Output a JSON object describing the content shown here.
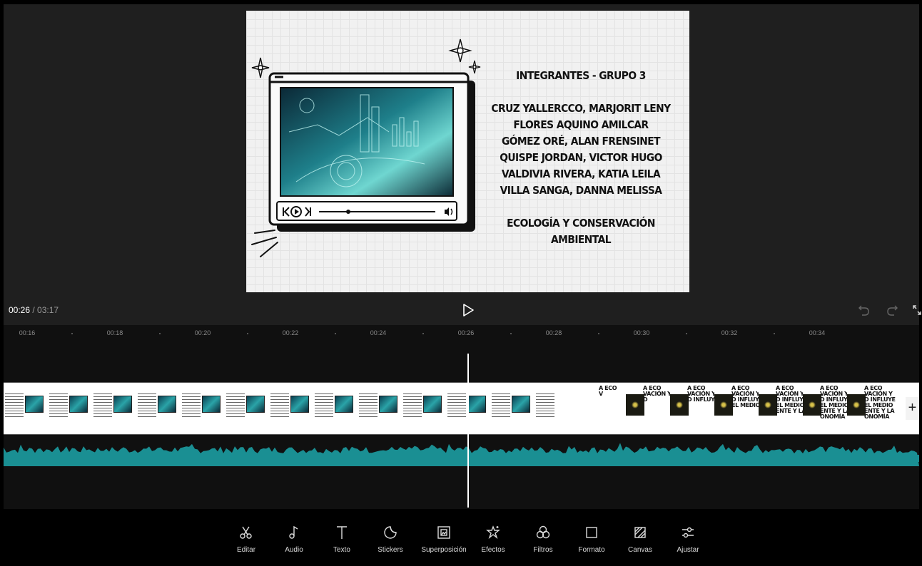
{
  "preview": {
    "slide": {
      "title": "INTEGRANTES - GRUPO 3",
      "members": [
        "CRUZ YALLERCCO, MARJORIT LENY",
        "FLORES AQUINO AMILCAR",
        "GÓMEZ ORÉ, ALAN FRENSINET",
        "QUISPE JORDAN, VICTOR HUGO",
        "VALDIVIA RIVERA, KATIA LEILA",
        "VILLA SANGA, DANNA MELISSA"
      ],
      "course_line1": "ECOLOGÍA Y CONSERVACIÓN",
      "course_line2": "AMBIENTAL"
    }
  },
  "playback": {
    "current": "00:26",
    "separator": " / ",
    "total": "03:17"
  },
  "icons": {
    "play": "play-icon",
    "undo": "undo-icon",
    "redo": "redo-icon",
    "fullscreen": "fullscreen-icon",
    "add_clip": "plus-icon"
  },
  "timeline": {
    "ruler_labels": [
      "00:16",
      "00:18",
      "00:20",
      "00:22",
      "00:24",
      "00:26",
      "00:28",
      "00:30",
      "00:32",
      "00:34"
    ],
    "add_clip_label": "+",
    "second_clip_frames": [
      {
        "text": "A ECO\nV"
      },
      {
        "text": "A ECO\nVACIÓN Y\nD"
      },
      {
        "text": "A ECO\nVACIÓN Y\nD INFLUYE"
      },
      {
        "text": "A ECO\nVACIÓN Y\nD INFLUYE\nEL MEDIO"
      },
      {
        "text": "A ECO\nVACIÓN Y\nD INFLUYE\nEL MEDIO\nENTE Y LA"
      },
      {
        "text": "A ECO\nVACIÓN Y\nD INFLUYE\nEL MEDIO\nENTE Y LA\nONOMÍA"
      },
      {
        "text": "A ECO\nVACIÓN Y\nD INFLUYE\nEL MEDIO\nENTE Y LA\nONOMÍA"
      }
    ],
    "colors": {
      "audio_wave": "#1a8f93",
      "playhead": "#ffffff"
    }
  },
  "toolbar": {
    "items": [
      {
        "name": "Editar",
        "icon": "scissors-icon"
      },
      {
        "name": "Audio",
        "icon": "music-note-icon"
      },
      {
        "name": "Texto",
        "icon": "text-icon"
      },
      {
        "name": "Stickers",
        "icon": "sticker-icon"
      },
      {
        "name": "Superposición",
        "icon": "overlay-icon"
      },
      {
        "name": "Efectos",
        "icon": "effects-star-icon"
      },
      {
        "name": "Filtros",
        "icon": "filters-icon"
      },
      {
        "name": "Formato",
        "icon": "format-square-icon"
      },
      {
        "name": "Canvas",
        "icon": "canvas-icon"
      },
      {
        "name": "Ajustar",
        "icon": "adjust-sliders-icon"
      }
    ]
  }
}
